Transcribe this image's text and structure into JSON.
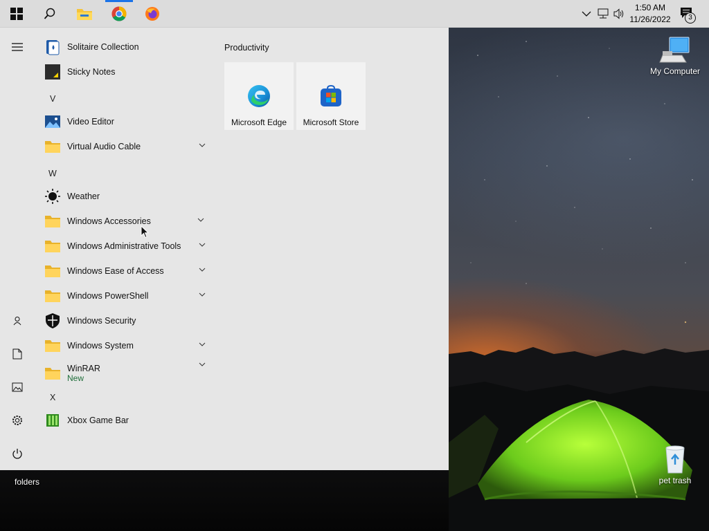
{
  "taskbar": {
    "start_icon": "windows-logo-icon",
    "search_icon": "search-icon",
    "pinned": [
      {
        "name": "file-explorer",
        "icon": "folder-icon"
      },
      {
        "name": "google-chrome",
        "icon": "chrome-icon"
      },
      {
        "name": "firefox",
        "icon": "firefox-icon"
      }
    ],
    "clock": {
      "time": "1:50 AM",
      "date": "11/26/2022"
    },
    "notification_count": "3",
    "accent": "#1a73e8"
  },
  "desktop": {
    "icons": [
      {
        "label": "My Computer",
        "icon": "computer-icon"
      },
      {
        "label": "pet trash",
        "icon": "recycle-bin-icon"
      },
      {
        "label": "folders",
        "icon": "folder-icon"
      }
    ]
  },
  "start_menu": {
    "rail": [
      "hamburger-menu-icon",
      "user-icon",
      "documents-icon",
      "pictures-icon",
      "settings-icon",
      "power-icon"
    ],
    "apps": [
      {
        "label": "Solitaire Collection",
        "icon": "solitaire-icon"
      },
      {
        "label": "Sticky Notes",
        "icon": "sticky-notes-icon"
      },
      {
        "letter": "V"
      },
      {
        "label": "Video Editor",
        "icon": "video-editor-icon"
      },
      {
        "label": "Virtual Audio Cable",
        "icon": "folder-icon",
        "expandable": true
      },
      {
        "letter": "W"
      },
      {
        "label": "Weather",
        "icon": "weather-sun-icon"
      },
      {
        "label": "Windows Accessories",
        "icon": "folder-icon",
        "expandable": true
      },
      {
        "label": "Windows Administrative Tools",
        "icon": "folder-icon",
        "expandable": true
      },
      {
        "label": "Windows Ease of Access",
        "icon": "folder-icon",
        "expandable": true
      },
      {
        "label": "Windows PowerShell",
        "icon": "folder-icon",
        "expandable": true
      },
      {
        "label": "Windows Security",
        "icon": "shield-icon"
      },
      {
        "label": "Windows System",
        "icon": "folder-icon",
        "expandable": true
      },
      {
        "label": "WinRAR",
        "icon": "folder-icon",
        "expandable": true,
        "badge": "New"
      },
      {
        "letter": "X"
      },
      {
        "label": "Xbox Game Bar",
        "icon": "xbox-game-bar-icon"
      }
    ],
    "tile_group": {
      "title": "Productivity",
      "tiles": [
        {
          "label": "Microsoft Edge",
          "icon": "edge-icon"
        },
        {
          "label": "Microsoft Store",
          "icon": "store-icon"
        }
      ]
    },
    "background": "#e6e6e6"
  }
}
